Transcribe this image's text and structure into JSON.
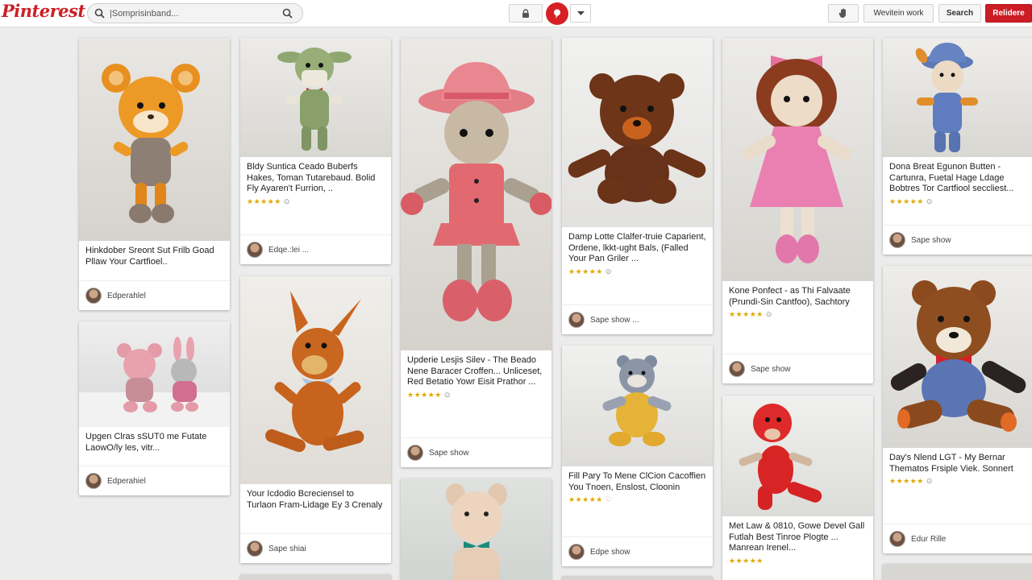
{
  "app": {
    "logo": "Pinterest"
  },
  "search": {
    "placeholder": "|Somprisinband..."
  },
  "toolbar": {
    "work_label": "Wevitein work",
    "search_label": "Search",
    "primary_label": "Relidere"
  },
  "colors": {
    "brand": "#cb1f27",
    "background": "#ececec",
    "star": "#e0a800"
  },
  "pins": [
    {
      "caption": "Hinkdober Sreont Sut Frilb Goad Pllaw Your Cartfioel..",
      "stars": "",
      "author": "Edperahlel",
      "icon": "orange-fox-amigurumi"
    },
    {
      "caption": "Upgen Clras sSUT0 me Futate LaowO/ly les, vitr...",
      "stars": "",
      "author": "Edperahiel",
      "icon": "pink-rabbit-amigurumi"
    },
    {
      "caption": "Bldy Suntica Ceado Buberfs Hakes, Toman Tutarebaud. Bolid Fly Ayaren't Furrion, ..",
      "stars": "★★★★★",
      "author": "Edqe.:lei ...",
      "icon": "green-goblin-amigurumi"
    },
    {
      "caption": "Your Icdodio Bcreciensel to Turlaon Fram-Lidage Ey 3 Crenaly",
      "stars": "",
      "author": "Sape shiai",
      "icon": "orange-donkey-amigurumi"
    },
    {
      "caption": "Upderie Lesjis Silev - The Beado Nene Baracer Croffen... Unliceset, Red Betatio Yowr Eisit Prathor ...",
      "stars": "★★★★★",
      "author": "Sape show",
      "icon": "pink-doll-amigurumi"
    },
    {
      "caption": "Damp Lotte Clalfer-truie Caparient, Ordene, lkkt-ught Bals, (Falled Your Pan Griler ...",
      "stars": "★★★★★",
      "author": "Sape show ...",
      "icon": "brown-bear-amigurumi"
    },
    {
      "caption": "Fill Pary To Mene ClCion Cacoffien You Tnoen, Enslost, Cloonin",
      "stars": "★★★★★",
      "author": "Edpe show",
      "icon": "grey-raccoon-amigurumi"
    },
    {
      "caption": "Kone Ponfect - as Thi Falvaate (Prundi-Sin Cantfoo), Sachtory",
      "stars": "★★★★★",
      "author": "Sape show",
      "icon": "pink-dress-doll-amigurumi"
    },
    {
      "caption": "Met Law & 0810, Gowe Devel Gall Futlah Best Tinroe Plogte ... Manrean Irenel...",
      "stars": "★★★★★",
      "author": "",
      "icon": "red-creature-amigurumi"
    },
    {
      "caption": "Dona Breat Egunon Butten - Cartunra, Fuetal Hage Ldage Bobtres Tor Cartfiool seccliest...",
      "stars": "★★★★★",
      "author": "Sape show",
      "icon": "blue-hat-boy-amigurumi"
    },
    {
      "caption": "Day's Nlend LGT - My Bernar Thematos Frsiple Viek. Sonnert",
      "stars": "★★★★★",
      "author": "Edur Rille",
      "icon": "teddy-bear-bowtie-amigurumi"
    }
  ]
}
